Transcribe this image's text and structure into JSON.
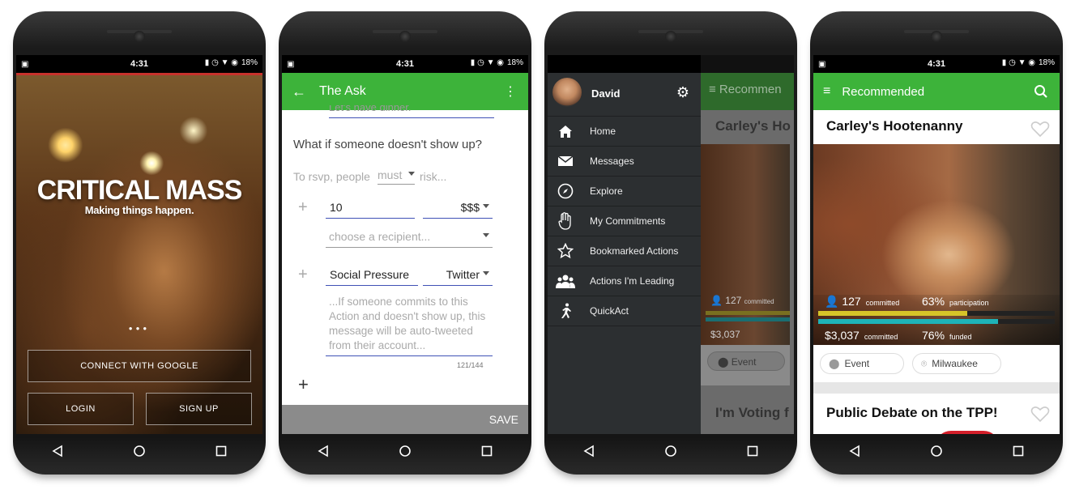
{
  "status": {
    "time": "4:31",
    "battery": "18%"
  },
  "phone1": {
    "title": "CRITICAL MASS",
    "subtitle": "Making things happen.",
    "connect_google": "CONNECT WITH GOOGLE",
    "login": "LOGIN",
    "signup": "SIGN UP"
  },
  "phone2": {
    "title": "The Ask",
    "faded_field": "Let's have dinner.",
    "question": "What if someone doesn't show up?",
    "rsvp_prefix": "To rsvp, people",
    "rsvp_mode": "must",
    "rsvp_suffix": "risk...",
    "amount": "10",
    "currency": "$$$",
    "recipient_placeholder": "choose a recipient...",
    "pressure": "Social Pressure",
    "platform": "Twitter",
    "message_placeholder": "...If someone commits to this Action and doesn't show up, this message will be auto-tweeted from their account...",
    "char_count": "121/144",
    "save": "SAVE",
    "accent": "#3db33a"
  },
  "phone3": {
    "user": "David",
    "bg_title": "Recommen",
    "bg_card1": "Carley's Ho",
    "bg_card2": "I'm Voting f",
    "bg_committed_count": "127",
    "bg_committed_label": "committed",
    "bg_funds": "$3,037",
    "bg_chip": "Event",
    "menu": [
      {
        "label": "Home",
        "icon": "home-icon"
      },
      {
        "label": "Messages",
        "icon": "envelope-icon"
      },
      {
        "label": "Explore",
        "icon": "compass-icon"
      },
      {
        "label": "My Commitments",
        "icon": "hand-icon"
      },
      {
        "label": "Bookmarked Actions",
        "icon": "star-icon"
      },
      {
        "label": "Actions I'm Leading",
        "icon": "group-icon"
      },
      {
        "label": "QuickAct",
        "icon": "running-icon"
      }
    ]
  },
  "phone4": {
    "title": "Recommended",
    "card1_title": "Carley's Hootenanny",
    "committed_count": "127",
    "committed_label": "committed",
    "participation": "63%",
    "participation_label": "participation",
    "participation_pct": 0.63,
    "funds": "$3,037",
    "funds_label": "committed",
    "funded": "76%",
    "funded_label": "funded",
    "funded_pct": 0.76,
    "chip_event": "Event",
    "chip_location": "Milwaukee",
    "card2_title": "Public Debate on the TPP!",
    "colors": {
      "green": "#3db33a",
      "yellow": "#d6c428",
      "teal": "#1eb3b8"
    }
  }
}
